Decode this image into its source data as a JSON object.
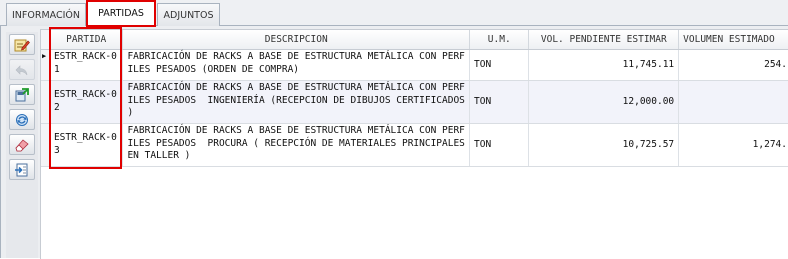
{
  "tabs": [
    {
      "label": "INFORMACIÓN",
      "active": false
    },
    {
      "label": "PARTIDAS",
      "active": true
    },
    {
      "label": "ADJUNTOS",
      "active": false
    }
  ],
  "toolbar": {
    "icons": [
      "edit-icon",
      "undo-icon",
      "export-icon",
      "refresh-icon",
      "eraser-icon",
      "import-icon"
    ]
  },
  "grid": {
    "columns": [
      "PARTIDA",
      "DESCRIPCION",
      "U.M.",
      "VOL. PENDIENTE ESTIMAR",
      "VOLUMEN ESTIMADO"
    ],
    "rows": [
      {
        "partida": "ESTR_RACK-01",
        "descripcion": "FABRICACIÓN DE RACKS A BASE DE ESTRUCTURA METÁLICA CON PERFILES PESADOS (ORDEN DE COMPRA)",
        "um": "TON",
        "vol_pendiente": "11,745.11",
        "vol_estimado": "254.",
        "current": true
      },
      {
        "partida": "ESTR_RACK-02",
        "descripcion": "FABRICACIÓN DE RACKS A BASE DE ESTRUCTURA METÁLICA CON PERFILES PESADOS  INGENIERÍA (RECEPCION DE DIBUJOS CERTIFICADOS )",
        "um": "TON",
        "vol_pendiente": "12,000.00",
        "vol_estimado": "",
        "current": false
      },
      {
        "partida": "ESTR_RACK-03",
        "descripcion": "FABRICACIÓN DE RACKS A BASE DE ESTRUCTURA METÁLICA CON PERFILES PESADOS  PROCURA ( RECEPCIÓN DE MATERIALES PRINCIPALES EN TALLER )",
        "um": "TON",
        "vol_pendiente": "10,725.57",
        "vol_estimado": "1,274.",
        "current": false
      }
    ]
  },
  "colors": {
    "highlight": "#e00000",
    "tab_border": "#a9b3bf",
    "row_alt": "#f2f3fa"
  }
}
